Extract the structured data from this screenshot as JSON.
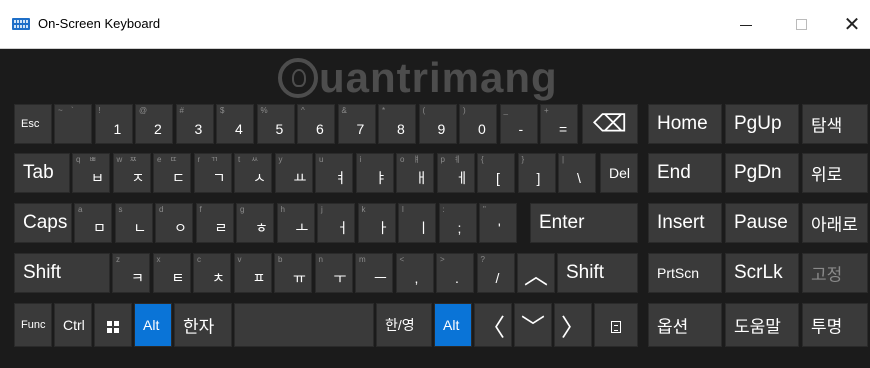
{
  "window": {
    "title": "On-Screen Keyboard",
    "close_glyph": "✕"
  },
  "watermark": {
    "text": "uantrimang"
  },
  "row1": [
    {
      "name": "esc",
      "label": "Esc"
    },
    {
      "name": "backtick",
      "sec": "~",
      "secr": "`",
      "main": ""
    },
    {
      "name": "1",
      "sec": "!",
      "main": "1"
    },
    {
      "name": "2",
      "sec": "@",
      "main": "2"
    },
    {
      "name": "3",
      "sec": "#",
      "main": "3"
    },
    {
      "name": "4",
      "sec": "$",
      "main": "4"
    },
    {
      "name": "5",
      "sec": "%",
      "main": "5"
    },
    {
      "name": "6",
      "sec": "^",
      "main": "6"
    },
    {
      "name": "7",
      "sec": "&",
      "main": "7"
    },
    {
      "name": "8",
      "sec": "*",
      "main": "8"
    },
    {
      "name": "9",
      "sec": "(",
      "main": "9"
    },
    {
      "name": "0",
      "sec": ")",
      "main": "0"
    },
    {
      "name": "minus",
      "sec": "_",
      "main": "-"
    },
    {
      "name": "equals",
      "sec": "+",
      "main": "="
    },
    {
      "name": "backspace",
      "glyph": "⌫"
    }
  ],
  "row2": [
    {
      "name": "tab",
      "label": "Tab"
    },
    {
      "name": "q",
      "sec": "q",
      "secr": "ㅃ",
      "main": "ㅂ"
    },
    {
      "name": "w",
      "sec": "w",
      "secr": "ㅉ",
      "main": "ㅈ"
    },
    {
      "name": "e",
      "sec": "e",
      "secr": "ㄸ",
      "main": "ㄷ"
    },
    {
      "name": "r",
      "sec": "r",
      "secr": "ㄲ",
      "main": "ㄱ"
    },
    {
      "name": "t",
      "sec": "t",
      "secr": "ㅆ",
      "main": "ㅅ"
    },
    {
      "name": "y",
      "sec": "y",
      "main": "ㅛ"
    },
    {
      "name": "u",
      "sec": "u",
      "main": "ㅕ"
    },
    {
      "name": "i",
      "sec": "i",
      "main": "ㅑ"
    },
    {
      "name": "o",
      "sec": "o",
      "secr": "ㅒ",
      "main": "ㅐ"
    },
    {
      "name": "p",
      "sec": "p",
      "secr": "ㅖ",
      "main": "ㅔ"
    },
    {
      "name": "lbracket",
      "sec": "{",
      "main": "["
    },
    {
      "name": "rbracket",
      "sec": "}",
      "main": "]"
    },
    {
      "name": "backslash",
      "sec": "|",
      "main": "\\"
    },
    {
      "name": "del",
      "label": "Del"
    }
  ],
  "row3": [
    {
      "name": "caps",
      "label": "Caps"
    },
    {
      "name": "a",
      "sec": "a",
      "main": "ㅁ"
    },
    {
      "name": "s",
      "sec": "s",
      "main": "ㄴ"
    },
    {
      "name": "d",
      "sec": "d",
      "main": "ㅇ"
    },
    {
      "name": "f",
      "sec": "f",
      "main": "ㄹ"
    },
    {
      "name": "g",
      "sec": "g",
      "main": "ㅎ"
    },
    {
      "name": "h",
      "sec": "h",
      "main": "ㅗ"
    },
    {
      "name": "j",
      "sec": "j",
      "main": "ㅓ"
    },
    {
      "name": "k",
      "sec": "k",
      "main": "ㅏ"
    },
    {
      "name": "l",
      "sec": "l",
      "main": "ㅣ"
    },
    {
      "name": "semicolon",
      "sec": ":",
      "main": ";"
    },
    {
      "name": "quote",
      "sec": "\"",
      "main": "'"
    },
    {
      "name": "enter",
      "label": "Enter"
    }
  ],
  "row4": [
    {
      "name": "shift-left",
      "label": "Shift"
    },
    {
      "name": "z",
      "sec": "z",
      "main": "ㅋ"
    },
    {
      "name": "x",
      "sec": "x",
      "main": "ㅌ"
    },
    {
      "name": "c",
      "sec": "c",
      "main": "ㅊ"
    },
    {
      "name": "v",
      "sec": "v",
      "main": "ㅍ"
    },
    {
      "name": "b",
      "sec": "b",
      "main": "ㅠ"
    },
    {
      "name": "n",
      "sec": "n",
      "main": "ㅜ"
    },
    {
      "name": "m",
      "sec": "m",
      "main": "ㅡ"
    },
    {
      "name": "comma",
      "sec": "<",
      "main": ","
    },
    {
      "name": "period",
      "sec": ">",
      "main": "."
    },
    {
      "name": "slash",
      "sec": "?",
      "main": "/"
    },
    {
      "name": "up",
      "glyph": "︿"
    },
    {
      "name": "shift-right",
      "label": "Shift"
    }
  ],
  "row5": {
    "fn": "Func",
    "ctrl": "Ctrl",
    "alt_left": "Alt",
    "hanja": "한자",
    "hanyeong": "한/영",
    "alt_right": "Alt",
    "left": "〈",
    "down": "﹀",
    "right": "〉"
  },
  "nav": {
    "home": "Home",
    "pgup": "PgUp",
    "search": "탐색",
    "end": "End",
    "pgdn": "PgDn",
    "up": "위로",
    "insert": "Insert",
    "pause": "Pause",
    "down": "아래로",
    "prtscn": "PrtScn",
    "scrlk": "ScrLk",
    "fix": "고정",
    "options": "옵션",
    "help": "도움말",
    "fade": "투명"
  }
}
